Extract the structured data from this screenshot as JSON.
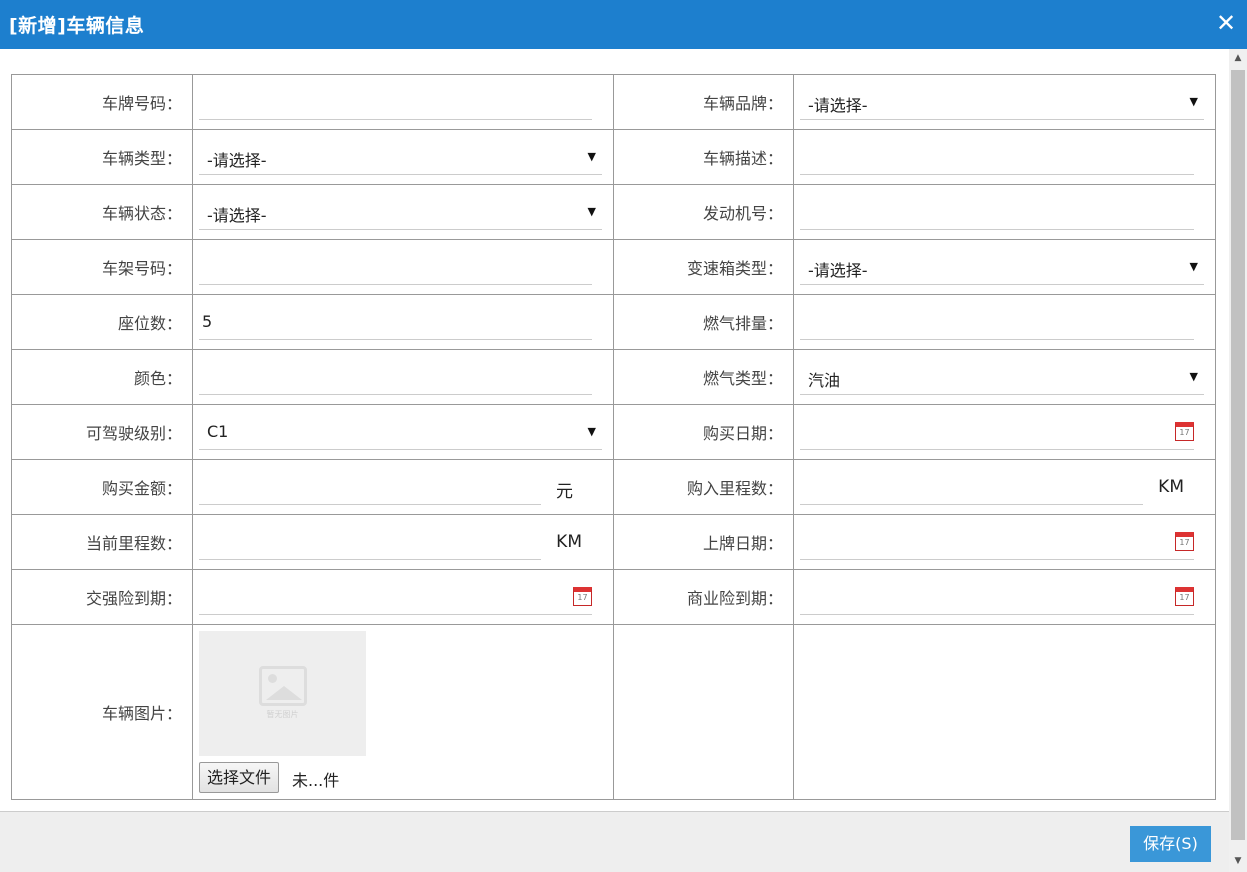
{
  "dialog": {
    "title": "[新增]车辆信息",
    "close_glyph": "✕"
  },
  "form": {
    "plate_number": {
      "label": "车牌号码：",
      "value": ""
    },
    "brand": {
      "label": "车辆品牌：",
      "value": "-请选择-"
    },
    "vehicle_type": {
      "label": "车辆类型：",
      "value": "-请选择-"
    },
    "description": {
      "label": "车辆描述：",
      "value": ""
    },
    "status": {
      "label": "车辆状态：",
      "value": "-请选择-"
    },
    "engine_number": {
      "label": "发动机号：",
      "value": ""
    },
    "frame_number": {
      "label": "车架号码：",
      "value": ""
    },
    "transmission": {
      "label": "变速箱类型：",
      "value": "-请选择-"
    },
    "seats": {
      "label": "座位数：",
      "value": "5"
    },
    "displacement": {
      "label": "燃气排量：",
      "value": ""
    },
    "color": {
      "label": "颜色：",
      "value": ""
    },
    "fuel_type": {
      "label": "燃气类型：",
      "value": "汽油"
    },
    "license_class": {
      "label": "可驾驶级别：",
      "value": "C1"
    },
    "purchase_date": {
      "label": "购买日期：",
      "value": ""
    },
    "purchase_amount": {
      "label": "购买金额：",
      "value": "",
      "unit": "元"
    },
    "purchase_mileage": {
      "label": "购入里程数：",
      "value": "",
      "unit": "KM"
    },
    "current_mileage": {
      "label": "当前里程数：",
      "value": "",
      "unit": "KM"
    },
    "plate_date": {
      "label": "上牌日期：",
      "value": ""
    },
    "compulsory_insurance": {
      "label": "交强险到期：",
      "value": ""
    },
    "commercial_insurance": {
      "label": "商业险到期：",
      "value": ""
    },
    "photo": {
      "label": "车辆图片：",
      "placeholder_caption": "暂无图片",
      "choose_button": "选择文件",
      "file_name": "未...件"
    }
  },
  "calendar_icon": {
    "name": "calendar-icon",
    "day": "17",
    "accent": "#d33"
  },
  "footer": {
    "save_label": "保存(S)"
  },
  "colors": {
    "titlebar": "#1d7fce",
    "save_button": "#3a97d8"
  }
}
